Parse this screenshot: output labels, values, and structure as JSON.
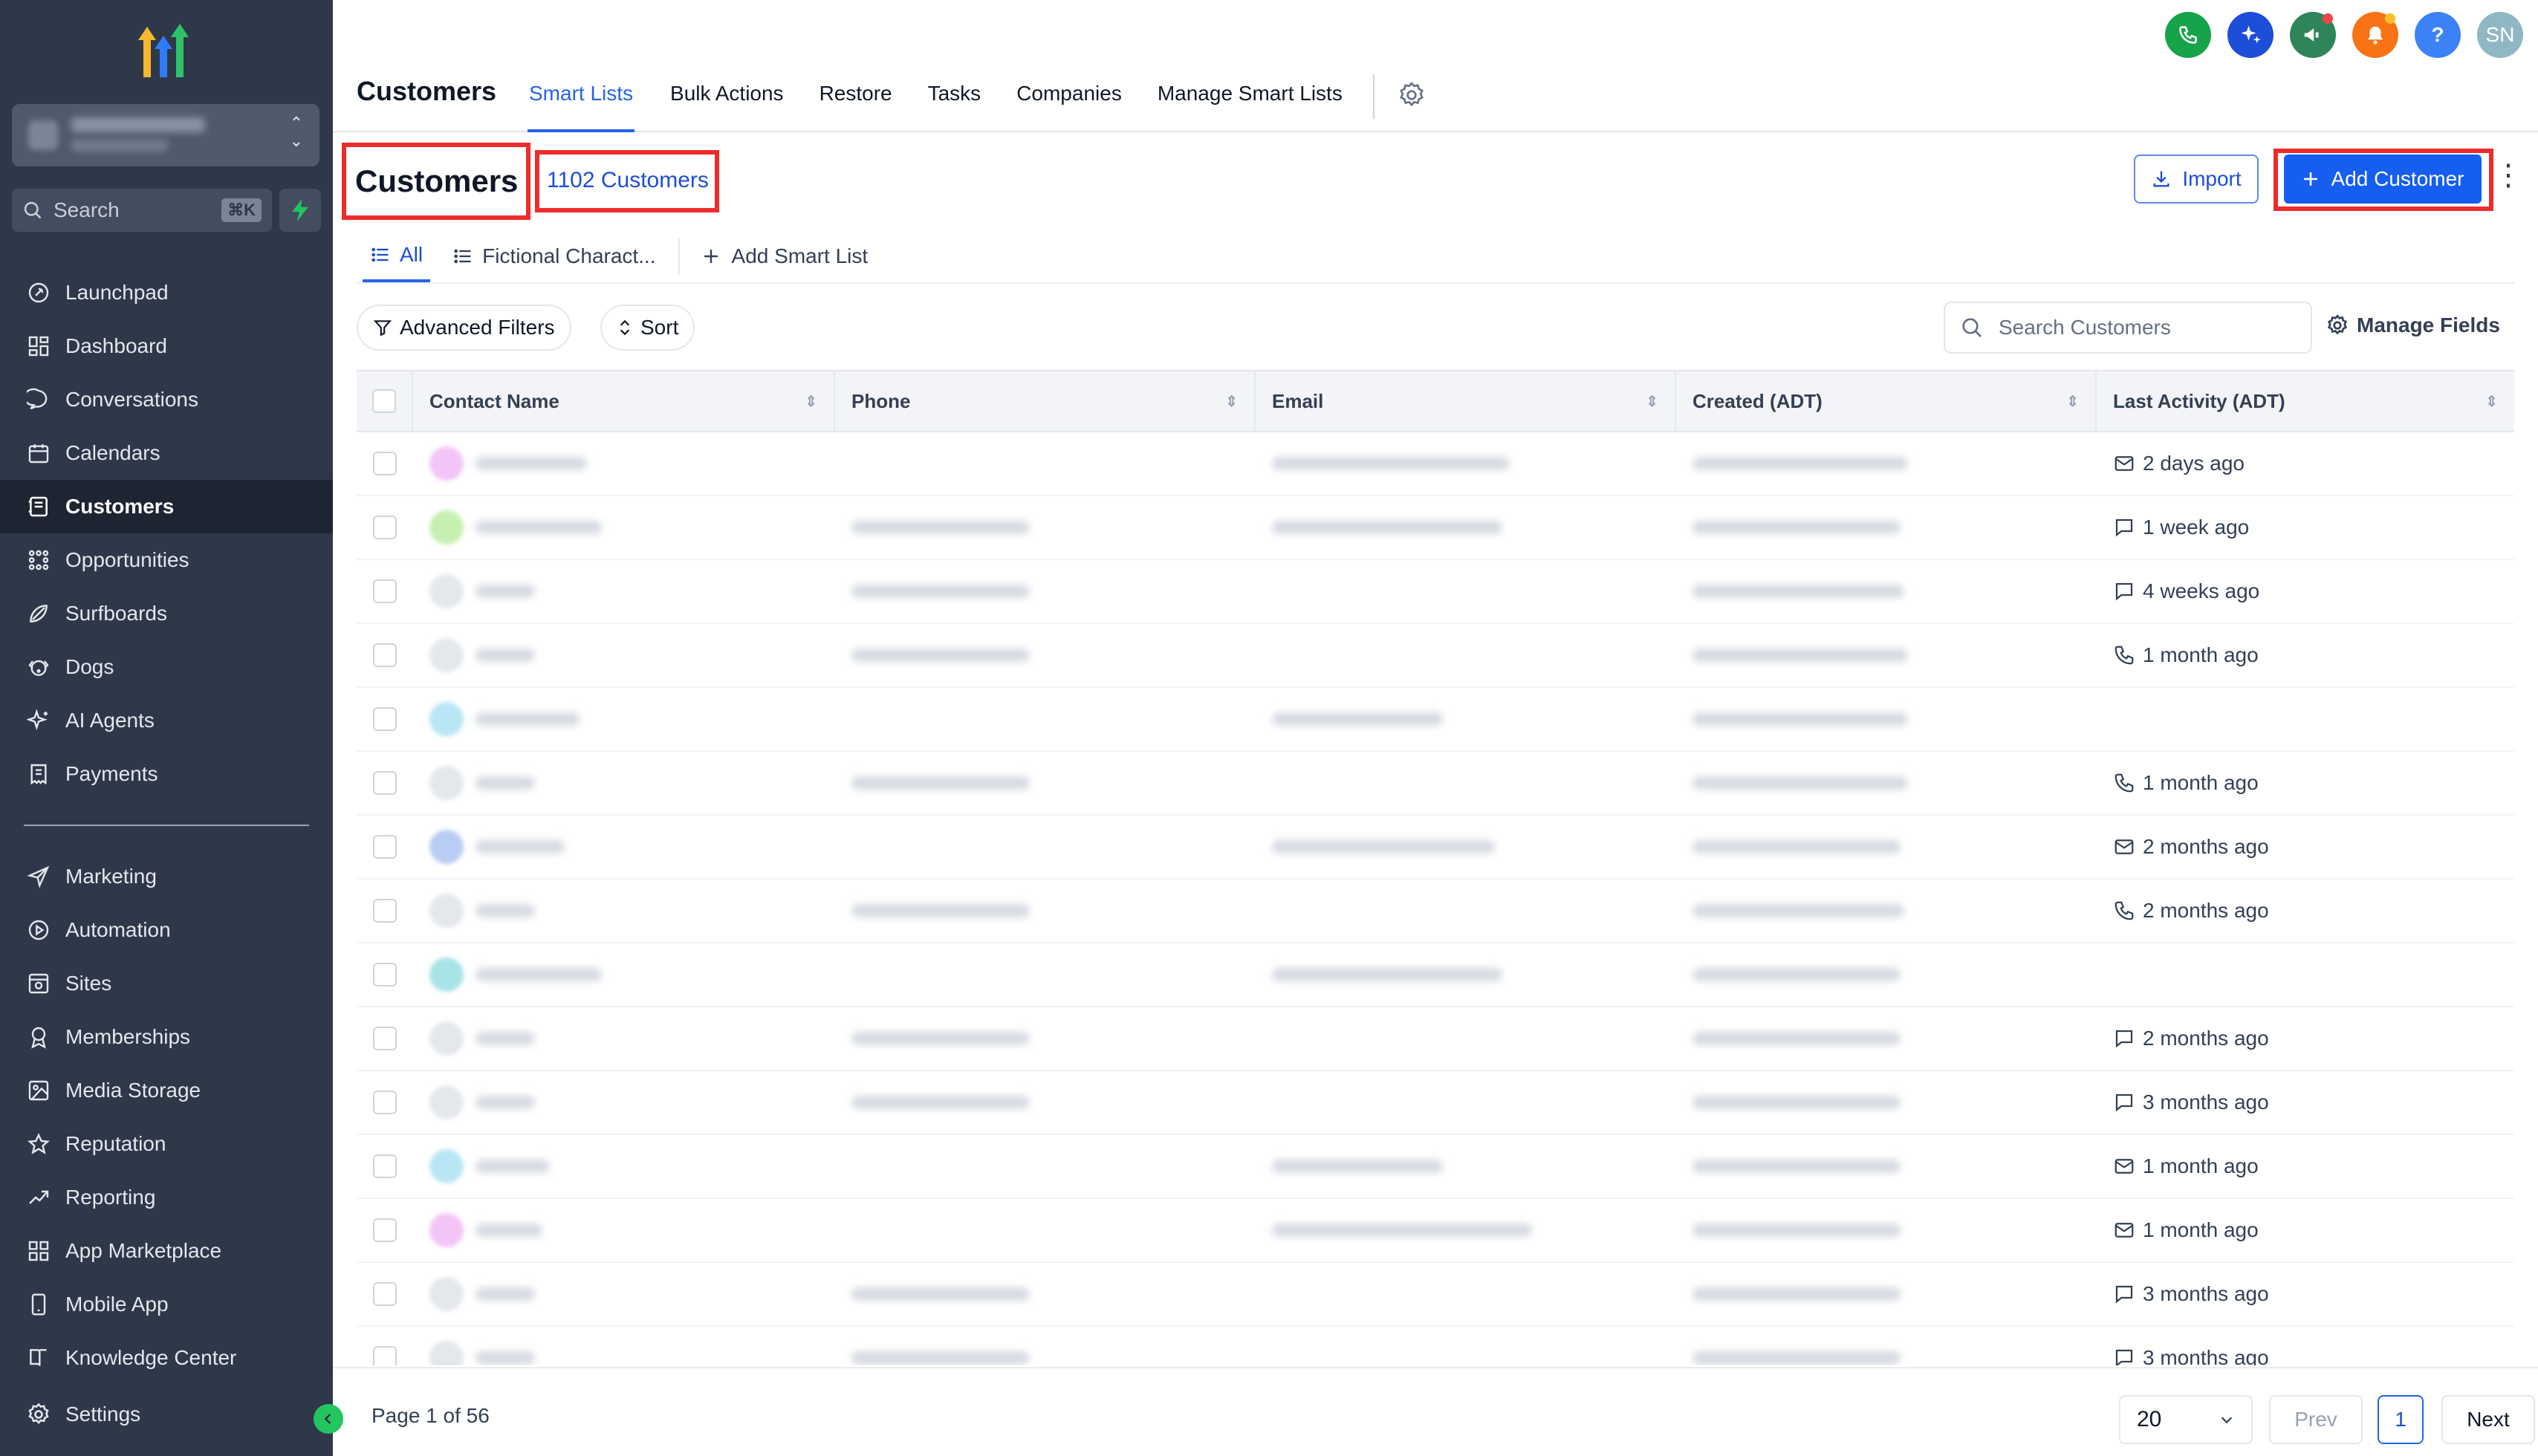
{
  "sidebar": {
    "search_label": "Search",
    "search_shortcut": "⌘K",
    "items": [
      {
        "label": "Launchpad",
        "icon": "rocket-icon"
      },
      {
        "label": "Dashboard",
        "icon": "dashboard-icon"
      },
      {
        "label": "Conversations",
        "icon": "chat-icon"
      },
      {
        "label": "Calendars",
        "icon": "calendar-icon"
      },
      {
        "label": "Customers",
        "icon": "contacts-icon",
        "active": true
      },
      {
        "label": "Opportunities",
        "icon": "pipeline-icon"
      },
      {
        "label": "Surfboards",
        "icon": "surfboard-icon"
      },
      {
        "label": "Dogs",
        "icon": "dog-icon"
      },
      {
        "label": "AI Agents",
        "icon": "sparkle-icon"
      },
      {
        "label": "Payments",
        "icon": "receipt-icon"
      }
    ],
    "items2": [
      {
        "label": "Marketing",
        "icon": "send-icon"
      },
      {
        "label": "Automation",
        "icon": "automation-icon"
      },
      {
        "label": "Sites",
        "icon": "sites-icon"
      },
      {
        "label": "Memberships",
        "icon": "membership-icon"
      },
      {
        "label": "Media Storage",
        "icon": "image-icon"
      },
      {
        "label": "Reputation",
        "icon": "star-icon"
      },
      {
        "label": "Reporting",
        "icon": "trend-icon"
      },
      {
        "label": "App Marketplace",
        "icon": "grid-icon"
      },
      {
        "label": "Mobile App",
        "icon": "phone-device-icon"
      },
      {
        "label": "Knowledge Center",
        "icon": "book-icon"
      }
    ],
    "settings_label": "Settings"
  },
  "topbar": {
    "title": "Customers",
    "tabs": [
      "Smart Lists",
      "Bulk Actions",
      "Restore",
      "Tasks",
      "Companies",
      "Manage Smart Lists"
    ],
    "avatar_initials": "SN",
    "colors": {
      "phone": "#16a34a",
      "ai": "#1d4ed8",
      "megaphone": "#2f855a",
      "bell": "#f97316",
      "help": "#3b82f6",
      "avatar": "#8fb8c4"
    }
  },
  "header": {
    "title": "Customers",
    "count": "1102 Customers",
    "import_label": "Import",
    "add_label": "Add Customer"
  },
  "subtabs": {
    "all": "All",
    "fictional": "Fictional Charact...",
    "add": "Add Smart List"
  },
  "filters": {
    "advanced": "Advanced Filters",
    "sort": "Sort",
    "search_placeholder": "Search Customers",
    "manage_fields": "Manage Fields"
  },
  "table": {
    "columns": [
      "Contact Name",
      "Phone",
      "Email",
      "Created (ADT)",
      "Last Activity (ADT)"
    ],
    "rows": [
      {
        "avatar": "#f3c4f5",
        "phone": false,
        "email": true,
        "activity_icon": "mail-icon",
        "activity": "2 days ago"
      },
      {
        "avatar": "#c5f0b0",
        "phone": true,
        "email": true,
        "activity_icon": "chat-bubble-icon",
        "activity": "1 week ago"
      },
      {
        "avatar": "#e4e7ec",
        "phone": true,
        "email": false,
        "activity_icon": "chat-bubble-icon",
        "activity": "4 weeks ago"
      },
      {
        "avatar": "#e4e7ec",
        "phone": true,
        "email": false,
        "activity_icon": "phone-icon",
        "activity": "1 month ago"
      },
      {
        "avatar": "#b9e6f5",
        "phone": false,
        "email": true,
        "activity_icon": "",
        "activity": ""
      },
      {
        "avatar": "#e4e7ec",
        "phone": true,
        "email": false,
        "activity_icon": "phone-icon",
        "activity": "1 month ago"
      },
      {
        "avatar": "#b8cdf3",
        "phone": false,
        "email": true,
        "activity_icon": "mail-icon",
        "activity": "2 months ago"
      },
      {
        "avatar": "#e4e7ec",
        "phone": true,
        "email": false,
        "activity_icon": "phone-icon",
        "activity": "2 months ago"
      },
      {
        "avatar": "#a8e3e6",
        "phone": false,
        "email": true,
        "activity_icon": "",
        "activity": ""
      },
      {
        "avatar": "#e4e7ec",
        "phone": true,
        "email": false,
        "activity_icon": "chat-bubble-icon",
        "activity": "2 months ago"
      },
      {
        "avatar": "#e4e7ec",
        "phone": true,
        "email": false,
        "activity_icon": "chat-bubble-icon",
        "activity": "3 months ago"
      },
      {
        "avatar": "#b9e6f5",
        "phone": false,
        "email": true,
        "activity_icon": "mail-icon",
        "activity": "1 month ago"
      },
      {
        "avatar": "#f3c4f5",
        "phone": false,
        "email": true,
        "activity_icon": "mail-icon",
        "activity": "1 month ago"
      },
      {
        "avatar": "#e4e7ec",
        "phone": true,
        "email": false,
        "activity_icon": "chat-bubble-icon",
        "activity": "3 months ago"
      },
      {
        "avatar": "#e4e7ec",
        "phone": true,
        "email": false,
        "activity_icon": "chat-bubble-icon",
        "activity": "3 months ago"
      }
    ]
  },
  "footer": {
    "page_info": "Page 1 of 56",
    "per_page": "20",
    "prev": "Prev",
    "current_page": "1",
    "next": "Next"
  }
}
